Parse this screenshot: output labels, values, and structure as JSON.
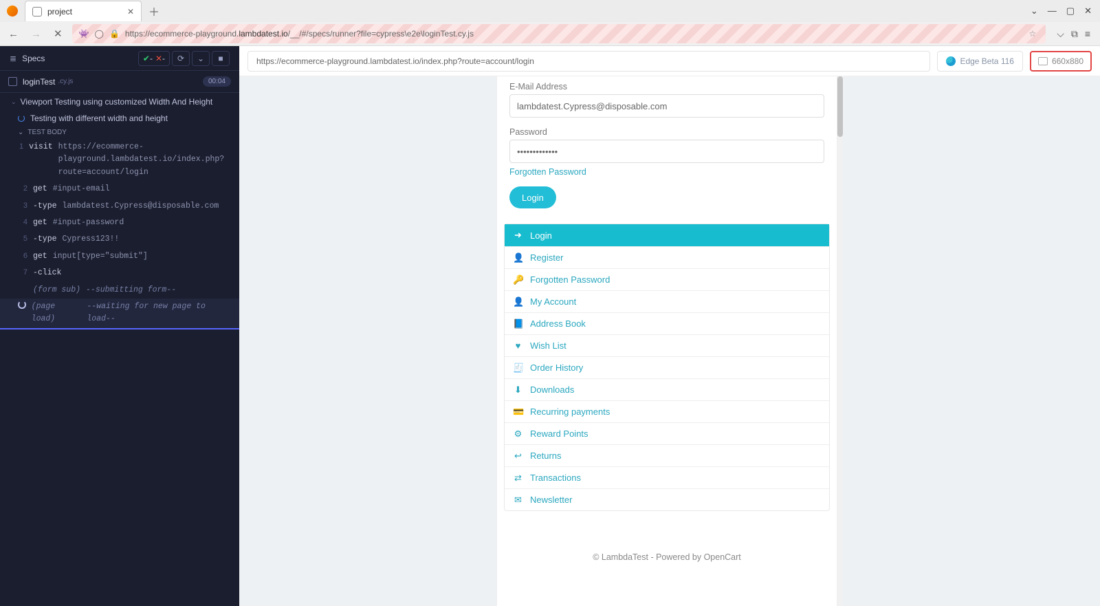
{
  "browser": {
    "tab_title": "project",
    "url_label": "https://ecommerce-playground.",
    "url_bold": "lambdatest.io",
    "url_rest": "/__/#/specs/runner?file=cypress\\e2e\\loginTest.cy.js",
    "chevron": "⌄",
    "min": "—",
    "max": "▢",
    "close": "✕"
  },
  "cypress": {
    "specs_title": "Specs",
    "pass_label": "-",
    "fail_label": "-",
    "spec_name": "loginTest",
    "spec_ext": ".cy.js",
    "elapsed": "00:04",
    "describe": "Viewport Testing using customized Width And Height",
    "it": "Testing with different width and height",
    "test_body": "TEST BODY",
    "commands": [
      {
        "n": "1",
        "kw": "visit",
        "arg": "https://ecommerce-playground.lambdatest.io/index.php?route=account/login"
      },
      {
        "n": "2",
        "kw": "get",
        "arg": "#input-email"
      },
      {
        "n": "3",
        "kw": "-type",
        "arg": "lambdatest.Cypress@disposable.com"
      },
      {
        "n": "4",
        "kw": "get",
        "arg": "#input-password"
      },
      {
        "n": "5",
        "kw": "-type",
        "arg": "Cypress123!!"
      },
      {
        "n": "6",
        "kw": "get",
        "arg": "input[type=\"submit\"]"
      },
      {
        "n": "7",
        "kw": "-click",
        "arg": ""
      }
    ],
    "meta1": {
      "kw": "(form sub)",
      "arg": "--submitting form--"
    },
    "meta2": {
      "kw": "(page load)",
      "arg": "--waiting for new page to load--"
    }
  },
  "runner": {
    "aut_url": "https://ecommerce-playground.lambdatest.io/index.php?route=account/login",
    "browser_name": "Edge Beta 116",
    "viewport": "660x880"
  },
  "aut": {
    "email_label": "E-Mail Address",
    "email_value": "lambdatest.Cypress@disposable.com",
    "password_label": "Password",
    "password_value": "•••••••••••••",
    "forgot": "Forgotten Password",
    "login_btn": "Login",
    "menu": [
      {
        "icon": "➜",
        "label": "Login",
        "active": true
      },
      {
        "icon": "👤",
        "label": "Register"
      },
      {
        "icon": "🔑",
        "label": "Forgotten Password"
      },
      {
        "icon": "👤",
        "label": "My Account"
      },
      {
        "icon": "📘",
        "label": "Address Book"
      },
      {
        "icon": "♥",
        "label": "Wish List"
      },
      {
        "icon": "🧾",
        "label": "Order History"
      },
      {
        "icon": "⬇",
        "label": "Downloads"
      },
      {
        "icon": "💳",
        "label": "Recurring payments"
      },
      {
        "icon": "⚙",
        "label": "Reward Points"
      },
      {
        "icon": "↩",
        "label": "Returns"
      },
      {
        "icon": "⇄",
        "label": "Transactions"
      },
      {
        "icon": "✉",
        "label": "Newsletter"
      }
    ],
    "footer": "© LambdaTest - Powered by OpenCart"
  }
}
